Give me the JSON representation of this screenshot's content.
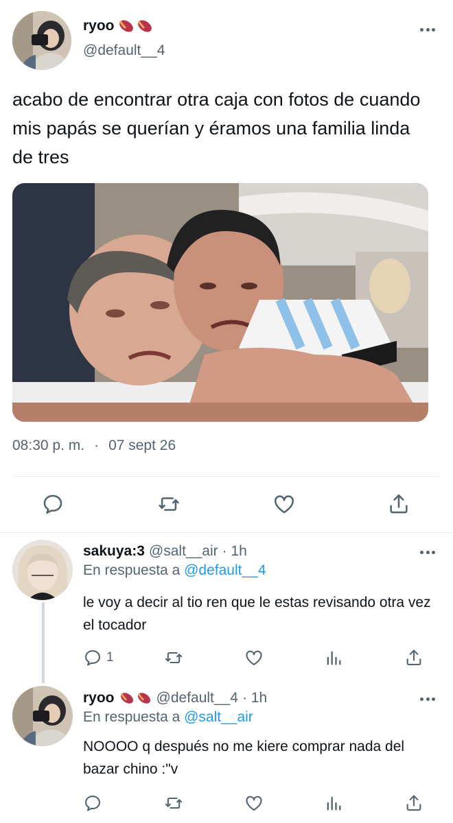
{
  "main_tweet": {
    "display_name": "ryoo",
    "handle": "@default__4",
    "text": "acabo de encontrar otra caja con fotos de cuando mis papás se querían y éramos una familia linda de tres",
    "time": "08:30 p. m.",
    "separator": "·",
    "date": "07 sept 26"
  },
  "replies": [
    {
      "display_name": "sakuya:3",
      "handle": "@salt__air",
      "age": "· 1h",
      "reply_prefix": "En respuesta a",
      "reply_to": "@default__4",
      "text": "le voy a decir al tio ren que le estas revisando otra vez el tocador",
      "reply_count": "1"
    },
    {
      "display_name": "ryoo",
      "handle": "@default__4",
      "age": "· 1h",
      "reply_prefix": "En respuesta a",
      "reply_to": "@salt__air",
      "text": "NOOOO q después no me kiere comprar nada del bazar chino :\"v"
    }
  ],
  "colors": {
    "text": "#0f1419",
    "muted": "#536471",
    "link": "#1d9bf0",
    "divider": "#e6ecf0"
  },
  "icons": [
    "more-icon",
    "reply-icon",
    "retweet-icon",
    "like-icon",
    "share-icon",
    "analytics-icon",
    "sweet-potato-emoji"
  ]
}
